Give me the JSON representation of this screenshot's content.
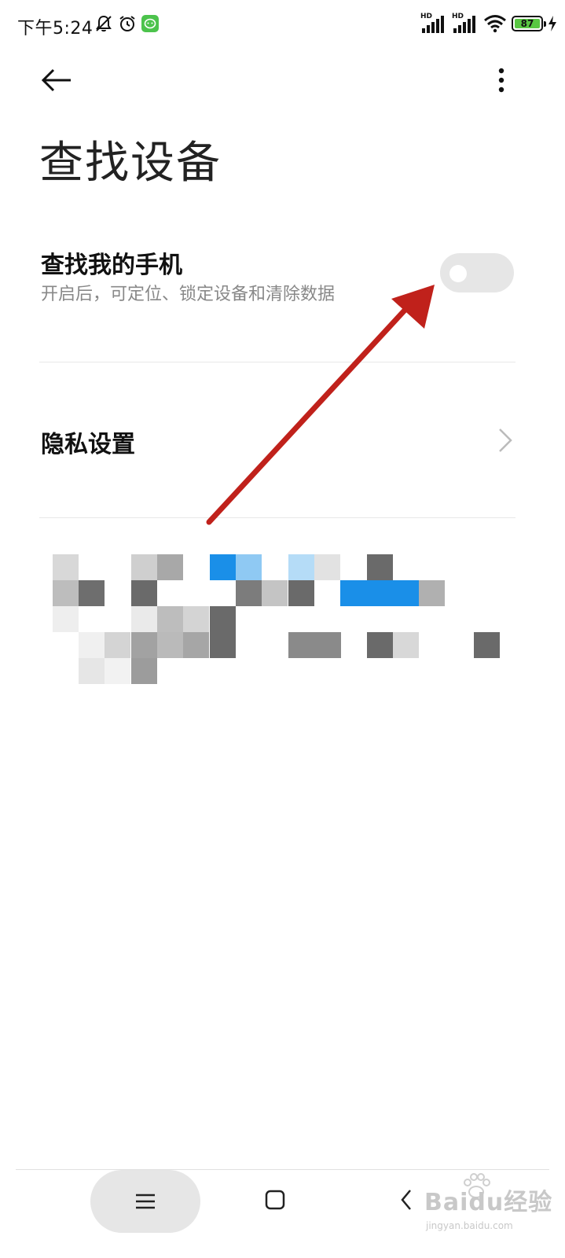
{
  "status_bar": {
    "time": "下午5:24",
    "icons": [
      "bell-off-icon",
      "alarm-icon",
      "wechat-icon"
    ],
    "signal_1_label": "HD",
    "signal_2_label": "HD",
    "battery_level": "87",
    "battery_color": "#58c642"
  },
  "header": {
    "back_icon": "arrow-left-icon",
    "more_icon": "more-vertical-icon",
    "title": "查找设备"
  },
  "find_my_phone": {
    "title": "查找我的手机",
    "subtitle": "开启后，可定位、锁定设备和清除数据",
    "toggle_on": false
  },
  "privacy": {
    "title": "隐私设置",
    "icon": "chevron-right-icon"
  },
  "nav_bar": {
    "menu_icon": "menu-icon",
    "home_icon": "home-square-icon",
    "back_icon": "chevron-left-icon"
  },
  "watermark": {
    "main": "Baidu经验",
    "sub": "jingyan.baidu.com"
  },
  "colors": {
    "annotation_arrow": "#c0211b",
    "toggle_track": "#e6e6e6",
    "accent_blue": "#1a8fe8"
  }
}
